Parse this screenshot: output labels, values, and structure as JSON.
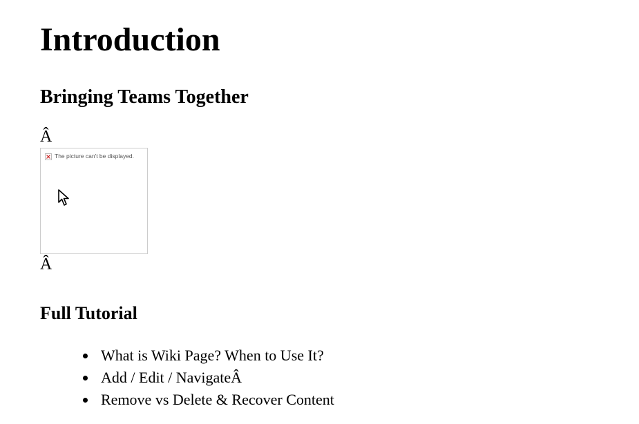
{
  "title": "Introduction",
  "subtitle": "Bringing Teams Together",
  "stray_before": "Â",
  "stray_after": "Â",
  "broken_image_text": "The picture can't be displayed.",
  "tutorial_heading": "Full Tutorial",
  "tutorial_items": [
    "What is Wiki Page? When to Use It?",
    "Add / Edit / NavigateÂ",
    "Remove vs Delete & Recover Content"
  ]
}
